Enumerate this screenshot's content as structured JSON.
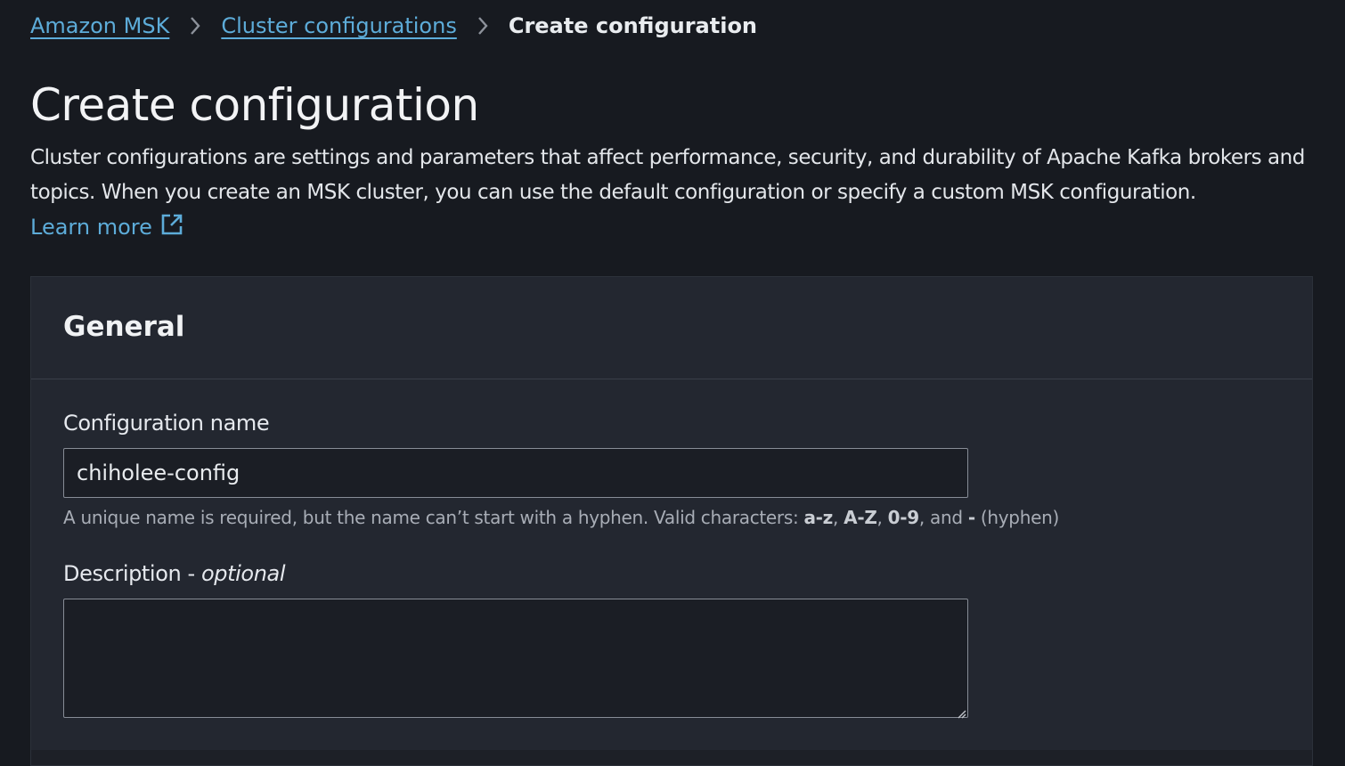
{
  "breadcrumb": {
    "items": [
      {
        "label": "Amazon MSK"
      },
      {
        "label": "Cluster configurations"
      },
      {
        "label": "Create configuration"
      }
    ]
  },
  "page": {
    "title": "Create configuration",
    "description": "Cluster configurations are settings and parameters that affect performance, security, and durability of Apache Kafka brokers and topics. When you create an MSK cluster, you can use the default configuration or specify a custom MSK configuration.",
    "learn_more": "Learn more"
  },
  "general": {
    "title": "General",
    "name_field": {
      "label": "Configuration name",
      "value": "chiholee-config",
      "hint_prefix": "A unique name is required, but the name can’t start with a hyphen. Valid characters: ",
      "hint_c1": "a-z",
      "hint_sep1": ", ",
      "hint_c2": "A-Z",
      "hint_sep2": ", ",
      "hint_c3": "0-9",
      "hint_sep3": ", and ",
      "hint_c4": "-",
      "hint_suffix": " (hyphen)"
    },
    "description_field": {
      "label": "Description - ",
      "optional": "optional",
      "value": ""
    }
  },
  "colors": {
    "background": "#171a20",
    "panel": "#232730",
    "link": "#5dacd9",
    "input_border": "#878c96"
  },
  "icons": {
    "breadcrumb_separator": "chevron-right-icon",
    "external_link": "external-link-icon",
    "resize": "resize-handle-icon"
  }
}
